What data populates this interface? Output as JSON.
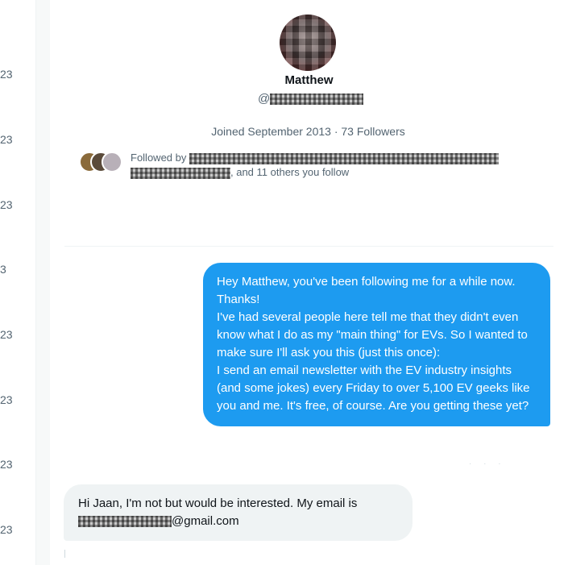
{
  "conversation_list": {
    "dates": [
      "23",
      "23",
      "23",
      "3",
      "23",
      "23",
      "23",
      "23"
    ]
  },
  "profile": {
    "name": "Matthew",
    "handle_prefix": "@",
    "joined_text": "Joined September 2013 · 73 Followers",
    "followed_by_prefix": "Followed by ",
    "followed_by_suffix": ", and 11 others you follow"
  },
  "messages": [
    {
      "direction": "outgoing",
      "text": "Hey Matthew, you've been following me for a while now. Thanks!\nI've had several people here tell me that they didn't even know what I do as my \"main thing\" for EVs. So I wanted to make sure I'll ask you this (just this once):\nI send an email newsletter with the EV industry insights (and some jokes) every Friday to over 5,100 EV geeks like you and me. It's free, of course. Are you getting these yet?"
    },
    {
      "direction": "incoming",
      "text_part1": "Hi Jaan, I'm not but would be interested. My email is",
      "text_part2": "@gmail.com"
    }
  ],
  "colors": {
    "accent": "#1d9bf0",
    "incoming_bubble": "#eff3f4",
    "secondary_text": "#536471"
  }
}
